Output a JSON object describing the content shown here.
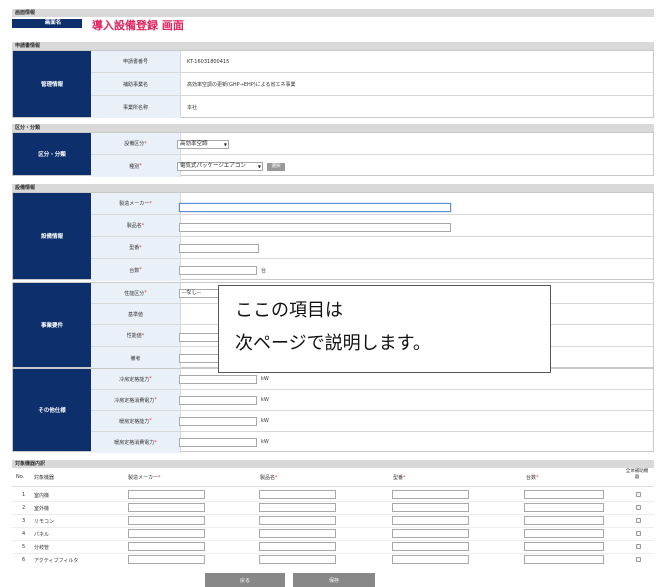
{
  "screen_info": {
    "section_label": "画面情報",
    "name_label": "画面名",
    "title": "導入設備登録 画面"
  },
  "application_info": {
    "section_label": "申請書情報",
    "block_label": "管理情報",
    "rows": [
      {
        "label": "申請書番号",
        "value": "KT-16031800415"
      },
      {
        "label": "補助事業名",
        "value": "高効率空調の更新(GHP→EHP)による省エネ事業"
      },
      {
        "label": "事業所名称",
        "value": "本社"
      }
    ]
  },
  "classification": {
    "section_label": "区分・分類",
    "block_label": "区分・分類",
    "equipment_category_label": "設備区分",
    "equipment_category_value": "高効率空調",
    "type_label": "種別",
    "type_value": "電気式パッケージエアコン",
    "type_button": "選択",
    "required_mark": "*"
  },
  "equipment_info": {
    "section_label": "設備情報",
    "block_label": "設備情報",
    "manufacturer_label": "製造メーカー",
    "product_name_label": "製品名",
    "model_label": "型番",
    "quantity_label": "台数",
    "quantity_unit": "台",
    "required_mark": "*"
  },
  "business_req": {
    "block_label": "事業要件",
    "performance_category_label": "性能区分",
    "performance_category_value": "--なし--",
    "standard_value_label": "基準値",
    "performance_value_label": "性能値",
    "remarks_label": "備考",
    "required_mark": "*"
  },
  "other_specs": {
    "block_label": "その他仕様",
    "rows": [
      {
        "label": "冷房定格能力",
        "unit": "kW"
      },
      {
        "label": "冷房定格消費電力",
        "unit": "kW"
      },
      {
        "label": "暖房定格能力",
        "unit": "kW"
      },
      {
        "label": "暖房定格消費電力",
        "unit": "kW"
      }
    ],
    "required_mark": "*"
  },
  "callout": {
    "line1": "ここの項目は",
    "line2": "次ページで説明します。"
  },
  "target_equipment": {
    "section_label": "対象機器内訳",
    "headers": {
      "no": "No.",
      "target": "対象機器",
      "manufacturer": "製造メーカー",
      "product": "製品名",
      "model": "型番",
      "quantity": "台数",
      "whole": "全体補助機器"
    },
    "required_mark": "*",
    "rows": [
      {
        "no": "1",
        "name": "室内機"
      },
      {
        "no": "2",
        "name": "室外機"
      },
      {
        "no": "3",
        "name": "リモコン"
      },
      {
        "no": "4",
        "name": "パネル"
      },
      {
        "no": "5",
        "name": "分岐管"
      },
      {
        "no": "6",
        "name": "アクティブフィルタ"
      }
    ]
  },
  "buttons": {
    "back": "戻る",
    "save": "保存"
  }
}
